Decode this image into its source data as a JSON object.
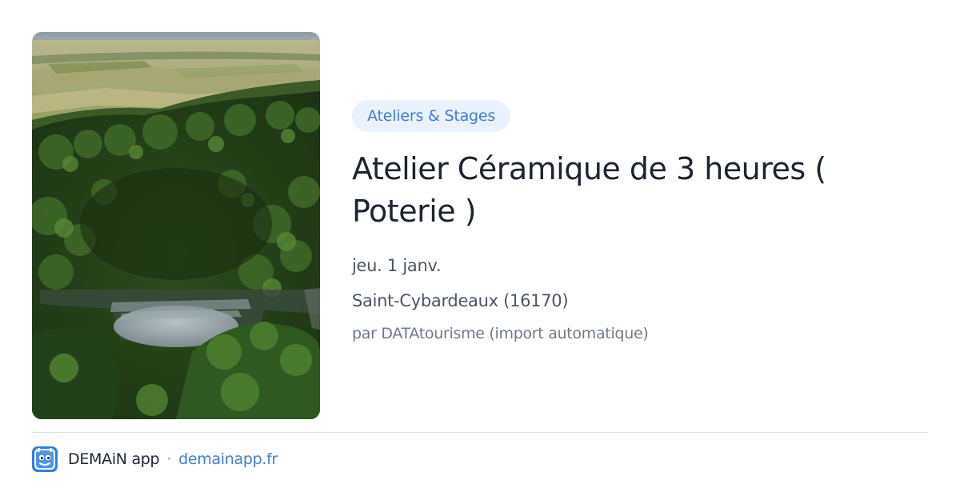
{
  "event": {
    "category": "Ateliers & Stages",
    "title": "Atelier Céramique de 3 heures ( Poterie )",
    "date": "jeu. 1 janv.",
    "location": "Saint-Cybardeaux (16170)",
    "source": "par DATAtourisme (import automatique)",
    "image": {
      "icon": "aerial-forest-amphitheatre-photo"
    }
  },
  "footer": {
    "app_name": "DEMAiN app",
    "separator": "·",
    "domain": "demainapp.fr",
    "app_icon": "demain-logo-icon"
  },
  "colors": {
    "accent": "#3d7fd6",
    "badge_bg": "#eaf2fd",
    "title": "#1c2430",
    "meta": "#4d5563",
    "muted": "#707988"
  }
}
